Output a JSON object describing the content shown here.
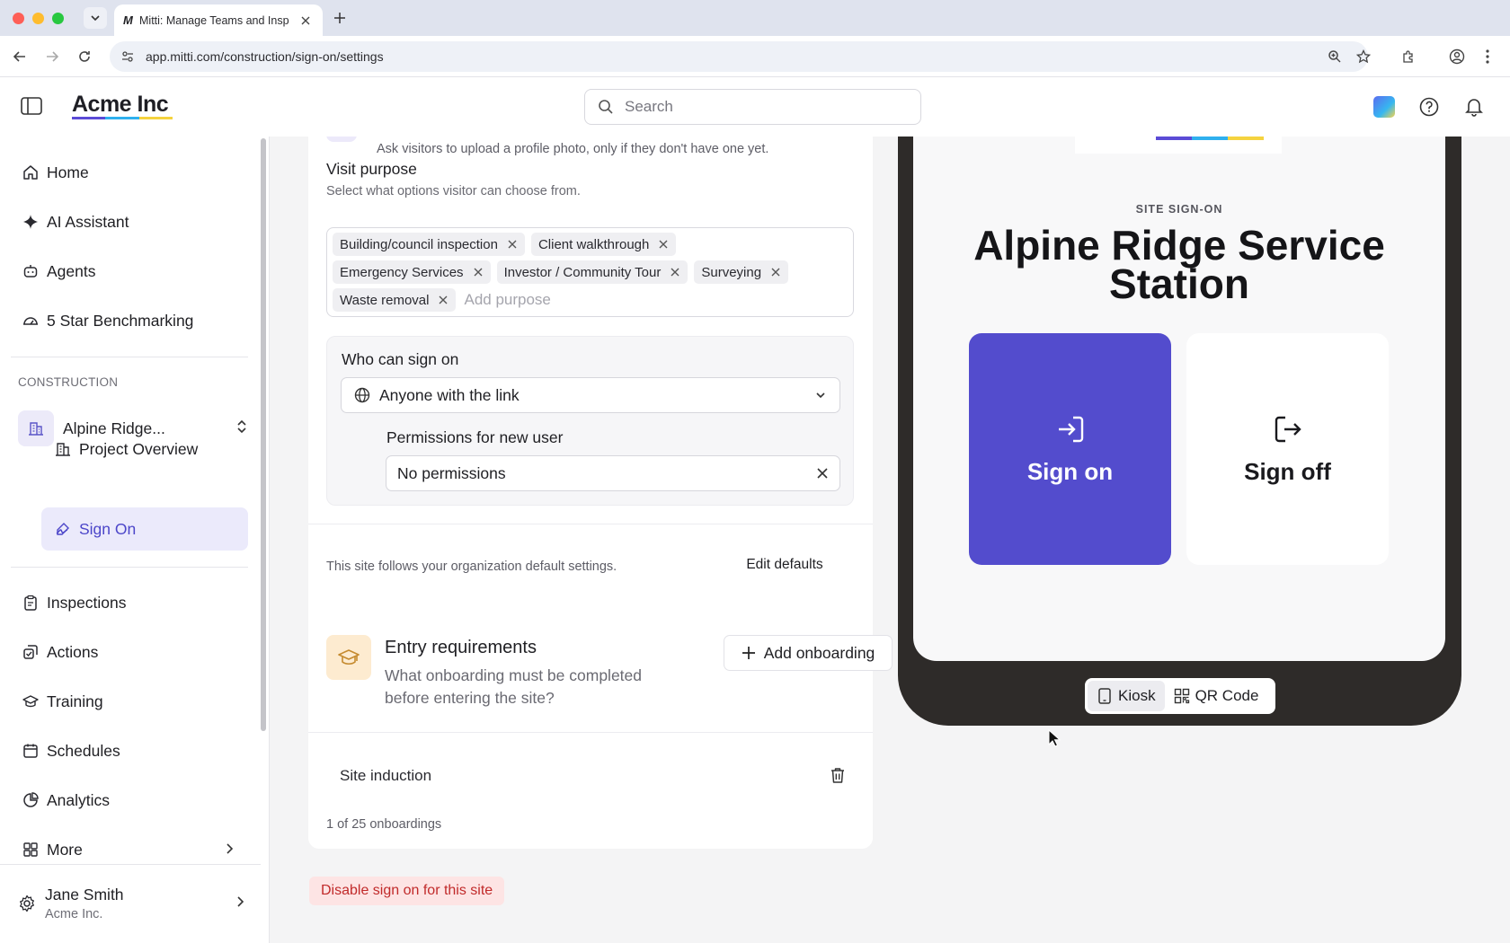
{
  "browser": {
    "tab_favicon": "M",
    "tab_title": "Mitti: Manage Teams and Insp",
    "url": "app.mitti.com/construction/sign-on/settings"
  },
  "header": {
    "brand": "Acme Inc",
    "search_placeholder": "Search"
  },
  "sidebar": {
    "top_items": [
      {
        "label": "Home",
        "icon": "home-icon"
      },
      {
        "label": "AI Assistant",
        "icon": "sparkle-icon"
      },
      {
        "label": "Agents",
        "icon": "robot-icon"
      },
      {
        "label": "5 Star Benchmarking",
        "icon": "gauge-icon"
      }
    ],
    "section_label": "CONSTRUCTION",
    "project_name": "Alpine Ridge...",
    "sub_items": [
      {
        "label": "Project Overview",
        "icon": "building-icon"
      },
      {
        "label": "Sign On",
        "icon": "signature-icon"
      }
    ],
    "bottom_items": [
      {
        "label": "Inspections",
        "icon": "clipboard-icon"
      },
      {
        "label": "Actions",
        "icon": "actions-icon"
      },
      {
        "label": "Training",
        "icon": "graduation-cap-icon"
      },
      {
        "label": "Schedules",
        "icon": "calendar-icon"
      },
      {
        "label": "Analytics",
        "icon": "pie-chart-icon"
      },
      {
        "label": "More",
        "icon": "grid-icon"
      }
    ],
    "user": {
      "name": "Jane Smith",
      "org": "Acme Inc."
    }
  },
  "settings": {
    "photo_hint": "Ask visitors to upload a profile photo, only if they don't have one yet.",
    "visit_purpose": {
      "title": "Visit purpose",
      "subtitle": "Select what options visitor can choose from.",
      "tags": [
        "Building/council inspection",
        "Client walkthrough",
        "Emergency Services",
        "Investor / Community Tour",
        "Surveying",
        "Waste removal"
      ],
      "input_placeholder": "Add purpose"
    },
    "who_can_sign_on": {
      "title": "Who can sign on",
      "value": "Anyone with the link"
    },
    "permissions": {
      "title": "Permissions for new user",
      "value": "No permissions"
    },
    "footer_text": "This site follows your organization default settings.",
    "edit_defaults_label": "Edit defaults"
  },
  "entry": {
    "title": "Entry requirements",
    "subtitle": "What onboarding must be completed before entering the site?",
    "add_label": "Add onboarding",
    "item": "Site induction",
    "count": "1 of 25 onboardings"
  },
  "disable_label": "Disable sign on for this site",
  "preview": {
    "eyebrow": "SITE SIGN-ON",
    "site_title": "Alpine Ridge Service Station",
    "sign_on_label": "Sign on",
    "sign_off_label": "Sign off",
    "modes": [
      "Kiosk",
      "QR Code"
    ],
    "active_mode": "Kiosk"
  },
  "colors": {
    "accent": "#534ccd",
    "sidebar_active_bg": "#ebeafb",
    "danger_text": "#c12a2a",
    "danger_bg": "#fde4e4",
    "phone_frame": "#2e2b29",
    "brand_underline": [
      "#5b4bd6",
      "#2fb0ee",
      "#f5d33f"
    ]
  }
}
